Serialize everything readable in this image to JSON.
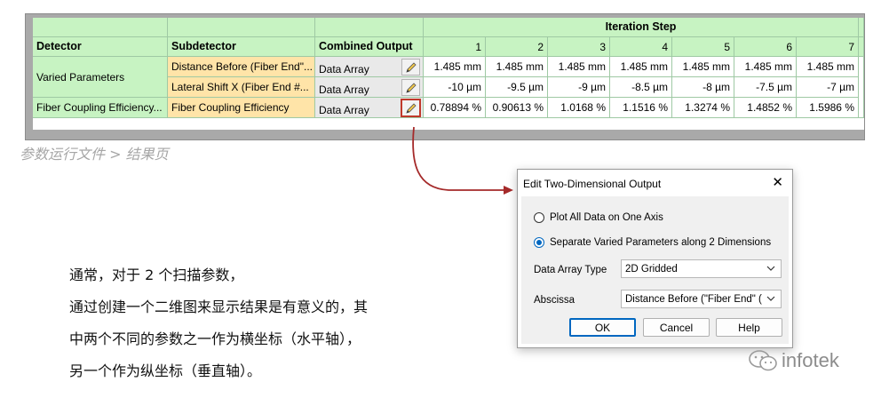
{
  "table": {
    "headers": {
      "detector": "Detector",
      "subdetector": "Subdetector",
      "combined_output": "Combined Output",
      "iteration_step": "Iteration Step",
      "steps": [
        "1",
        "2",
        "3",
        "4",
        "5",
        "6",
        "7"
      ]
    },
    "rows": [
      {
        "detector": "Varied Parameters",
        "subdetector": "Distance Before (Fiber End\"...",
        "output": "Data Array",
        "values": [
          "1.485 mm",
          "1.485 mm",
          "1.485 mm",
          "1.485 mm",
          "1.485 mm",
          "1.485 mm",
          "1.485 mm"
        ]
      },
      {
        "detector": "",
        "subdetector": "Lateral Shift X (Fiber End #...",
        "output": "Data Array",
        "values": [
          "-10 µm",
          "-9.5 µm",
          "-9 µm",
          "-8.5 µm",
          "-8 µm",
          "-7.5 µm",
          "-7 µm"
        ]
      },
      {
        "detector": "Fiber Coupling Efficiency...",
        "subdetector": "Fiber Coupling Efficiency",
        "output": "Data Array",
        "values": [
          "0.78894 %",
          "0.90613 %",
          "1.0168 %",
          "1.1516 %",
          "1.3274 %",
          "1.4852 %",
          "1.5986 %"
        ]
      }
    ]
  },
  "caption": "参数运行文件 > 结果页",
  "paragraph": [
    "通常，对于 2 个扫描参数，",
    "通过创建一个二维图来显示结果是有意义的，其",
    "中两个不同的参数之一作为横坐标（水平轴），",
    "另一个作为纵坐标（垂直轴）。"
  ],
  "dialog": {
    "title": "Edit Two-Dimensional Output",
    "radio_1": "Plot All Data on One Axis",
    "radio_2": "Separate Varied Parameters along 2 Dimensions",
    "selected_radio": 2,
    "data_array_type_label": "Data Array Type",
    "data_array_type_value": "2D Gridded",
    "abscissa_label": "Abscissa",
    "abscissa_value": "Distance Before (\"Fiber End\" (",
    "ok": "OK",
    "cancel": "Cancel",
    "help": "Help"
  },
  "logo": {
    "text": "infotek"
  },
  "colors": {
    "header_green": "#c7f3c2",
    "subdetector_orange": "#ffe4a8",
    "arrow_red": "#a52a2a",
    "accent_blue": "#0067c0"
  }
}
